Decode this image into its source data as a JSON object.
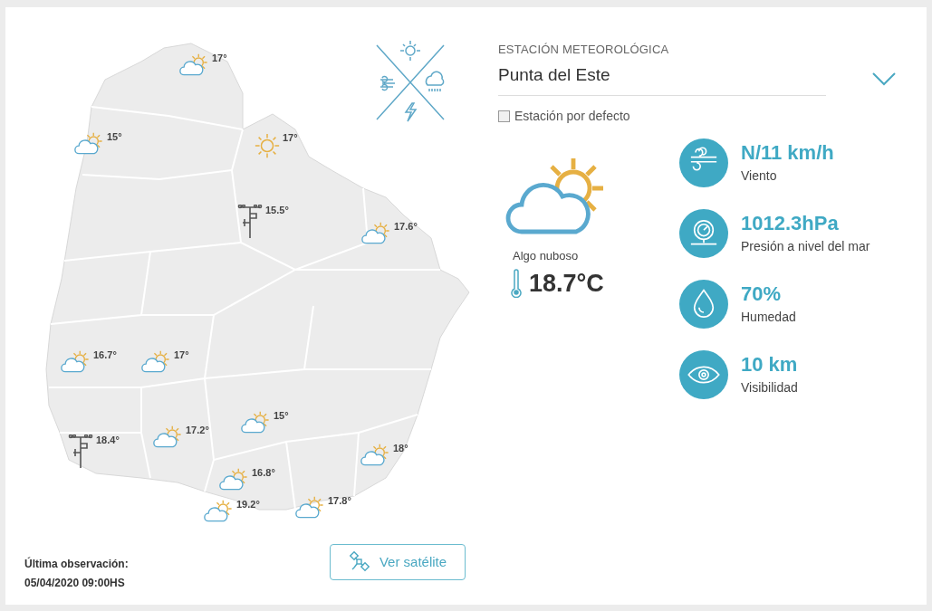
{
  "map": {
    "stations": [
      {
        "kind": "partly_cloudy",
        "temp": "17°"
      },
      {
        "kind": "partly_cloudy",
        "temp": "15°"
      },
      {
        "kind": "sunny",
        "temp": "17°"
      },
      {
        "kind": "instrument",
        "temp": "15.5°"
      },
      {
        "kind": "partly_cloudy",
        "temp": "17.6°"
      },
      {
        "kind": "partly_cloudy",
        "temp": "16.7°"
      },
      {
        "kind": "partly_cloudy",
        "temp": "17°"
      },
      {
        "kind": "partly_cloudy",
        "temp": "17.2°"
      },
      {
        "kind": "partly_cloudy",
        "temp": "15°"
      },
      {
        "kind": "instrument",
        "temp": "18.4°"
      },
      {
        "kind": "partly_cloudy",
        "temp": "18°"
      },
      {
        "kind": "partly_cloudy",
        "temp": "16.8°"
      },
      {
        "kind": "partly_cloudy",
        "temp": "19.2°"
      },
      {
        "kind": "partly_cloudy",
        "temp": "17.8°"
      }
    ]
  },
  "station": {
    "label": "ESTACIÓN METEOROLÓGICA",
    "value": "Punta del Este",
    "default_checkbox": {
      "label": "Estación por defecto",
      "checked": false
    }
  },
  "current": {
    "kind": "partly_cloudy",
    "condition": "Algo nuboso",
    "temperature": "18.7°C"
  },
  "metrics": [
    {
      "kind": "wind",
      "value": "N/11 km/h",
      "label": "Viento"
    },
    {
      "kind": "pressure",
      "value": "1012.3hPa",
      "label": "Presión a nivel del mar"
    },
    {
      "kind": "humidity",
      "value": "70%",
      "label": "Humedad"
    },
    {
      "kind": "visibility",
      "value": "10 km",
      "label": "Visibilidad"
    }
  ],
  "last_observation": {
    "label": "Última observación:",
    "value": "05/04/2020 09:00HS"
  },
  "satellite_button": "Ver satélite"
}
